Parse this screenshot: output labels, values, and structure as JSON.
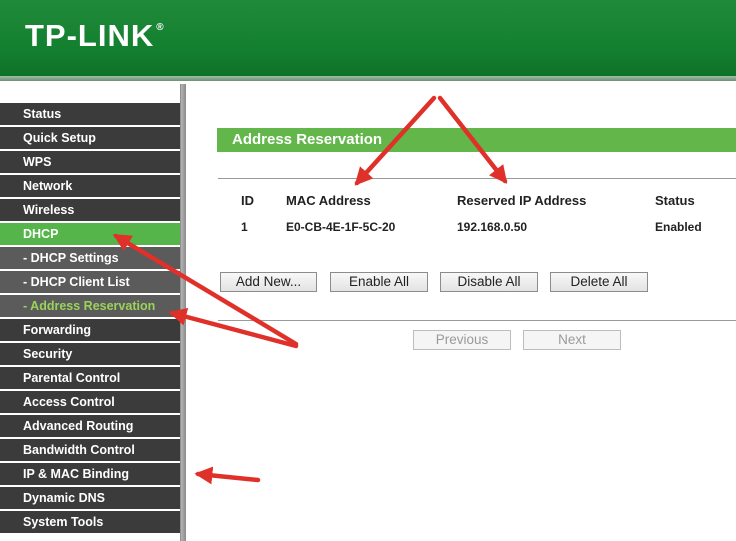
{
  "header": {
    "logo_text": "TP-LINK",
    "logo_mark": "®"
  },
  "sidebar": {
    "items": [
      {
        "label": "Status"
      },
      {
        "label": "Quick Setup"
      },
      {
        "label": "WPS"
      },
      {
        "label": "Network"
      },
      {
        "label": "Wireless"
      },
      {
        "label": "DHCP"
      },
      {
        "label": "- DHCP Settings"
      },
      {
        "label": "- DHCP Client List"
      },
      {
        "label": "- Address Reservation"
      },
      {
        "label": "Forwarding"
      },
      {
        "label": "Security"
      },
      {
        "label": "Parental Control"
      },
      {
        "label": "Access Control"
      },
      {
        "label": "Advanced Routing"
      },
      {
        "label": "Bandwidth Control"
      },
      {
        "label": "IP & MAC Binding"
      },
      {
        "label": "Dynamic DNS"
      },
      {
        "label": "System Tools"
      }
    ],
    "active": "DHCP",
    "current_sub": "- Address Reservation"
  },
  "main": {
    "section_title": "Address Reservation",
    "table": {
      "columns": [
        "ID",
        "MAC Address",
        "Reserved IP Address",
        "Status"
      ],
      "rows": [
        [
          "1",
          "E0-CB-4E-1F-5C-20",
          "192.168.0.50",
          "Enabled"
        ]
      ]
    },
    "buttons": {
      "add_new": "Add New...",
      "enable_all": "Enable All",
      "disable_all": "Disable All",
      "delete_all": "Delete All"
    },
    "pagination": {
      "previous": "Previous",
      "next": "Next"
    }
  },
  "colors": {
    "brand_green": "#138030",
    "accent_green": "#63b74a",
    "nav_dark": "#3b3b3b",
    "annotation_red": "#e0302a"
  }
}
